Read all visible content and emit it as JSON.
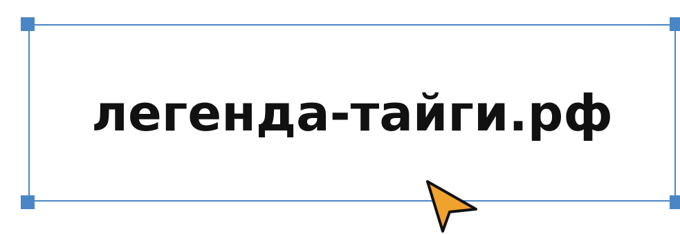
{
  "headline": {
    "text": "легенда-тайги.рф"
  },
  "selection": {
    "color": "#4a86c5"
  },
  "cursor": {
    "icon": "pointer-arrow-icon",
    "fill": "#f0a22e",
    "stroke": "#111111"
  }
}
